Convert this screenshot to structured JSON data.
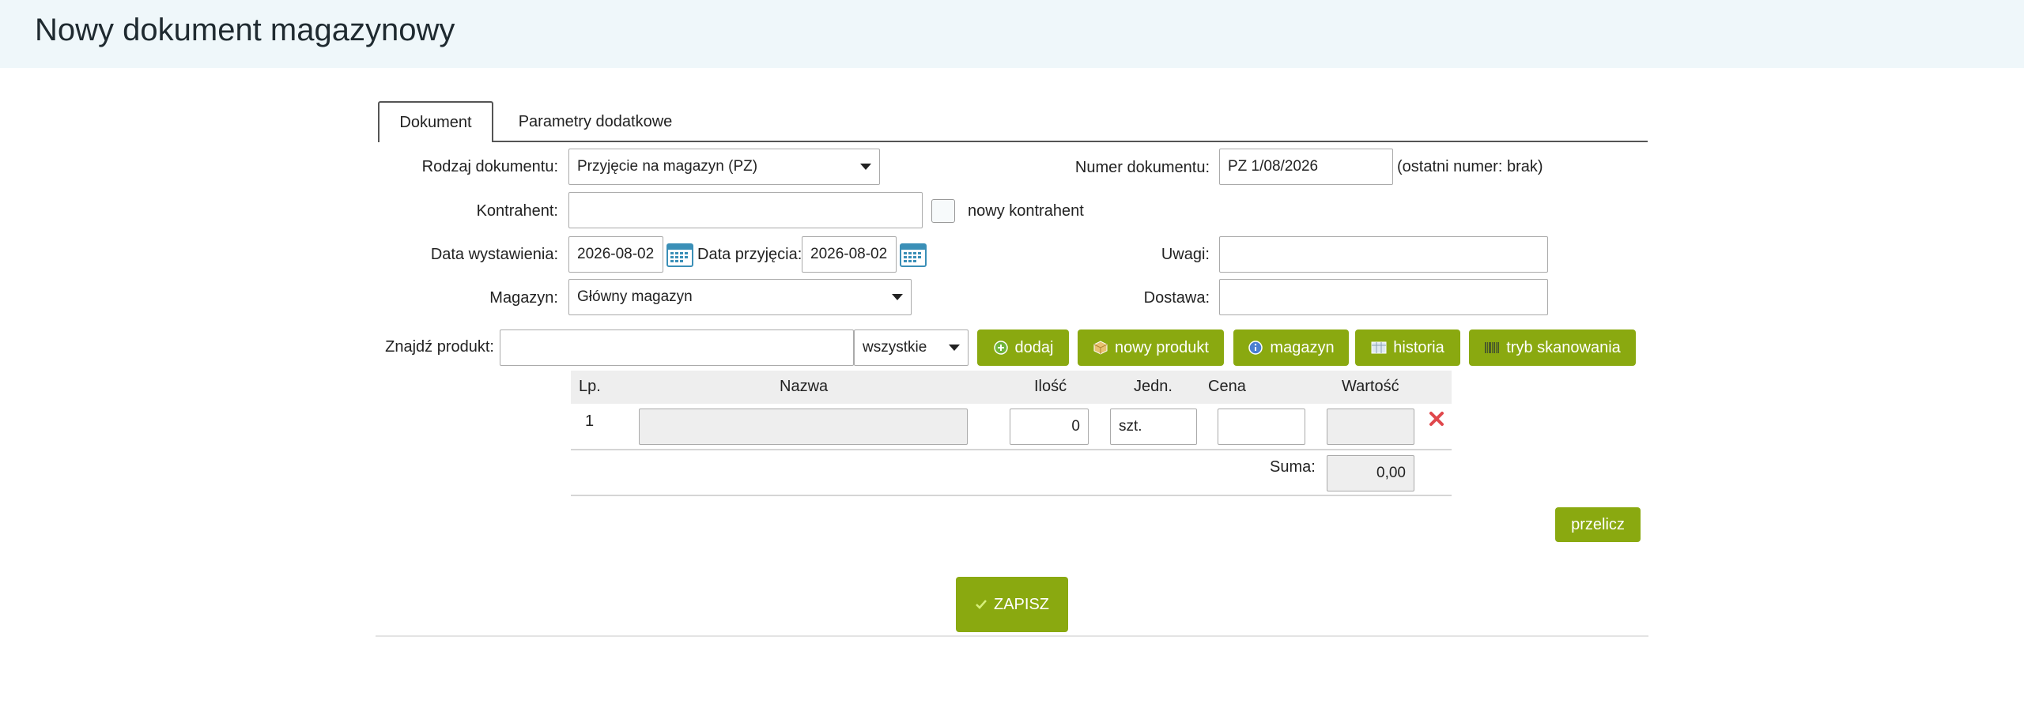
{
  "header": {
    "title": "Nowy dokument magazynowy"
  },
  "tabs": [
    {
      "label": "Dokument"
    },
    {
      "label": "Parametry dodatkowe"
    }
  ],
  "form": {
    "doc_type": {
      "label": "Rodzaj dokumentu:",
      "value": "Przyjęcie na magazyn (PZ)"
    },
    "doc_number": {
      "label": "Numer dokumentu:",
      "value": "PZ 1/08/2026",
      "note": "(ostatni numer: brak)"
    },
    "contractor": {
      "label": "Kontrahent:",
      "value": "",
      "new_label": "nowy kontrahent"
    },
    "issue_date": {
      "label": "Data wystawienia:",
      "value": "2026-08-02"
    },
    "receipt_date": {
      "label": "Data przyjęcia:",
      "value": "2026-08-02"
    },
    "notes": {
      "label": "Uwagi:",
      "value": ""
    },
    "warehouse": {
      "label": "Magazyn:",
      "value": "Główny magazyn"
    },
    "delivery": {
      "label": "Dostawa:",
      "value": ""
    },
    "find_product": {
      "label": "Znajdź produkt:",
      "value": "",
      "filter": "wszystkie"
    }
  },
  "actions": {
    "add": "dodaj",
    "new_product": "nowy produkt",
    "warehouse": "magazyn",
    "history": "historia",
    "scan_mode": "tryb skanowania",
    "recalc": "przelicz",
    "save": "ZAPISZ"
  },
  "table": {
    "columns": [
      "Lp.",
      "Nazwa",
      "Ilość",
      "Jedn.",
      "Cena",
      "Wartość"
    ],
    "rows": [
      {
        "lp": "1",
        "name": "",
        "qty": "0",
        "unit": "szt.",
        "price": "",
        "value": ""
      }
    ],
    "sum_label": "Suma:",
    "sum_value": "0,00"
  },
  "colors": {
    "accent": "#8aa910",
    "header_bg": "#eff7fa",
    "delete": "#e0474c"
  }
}
